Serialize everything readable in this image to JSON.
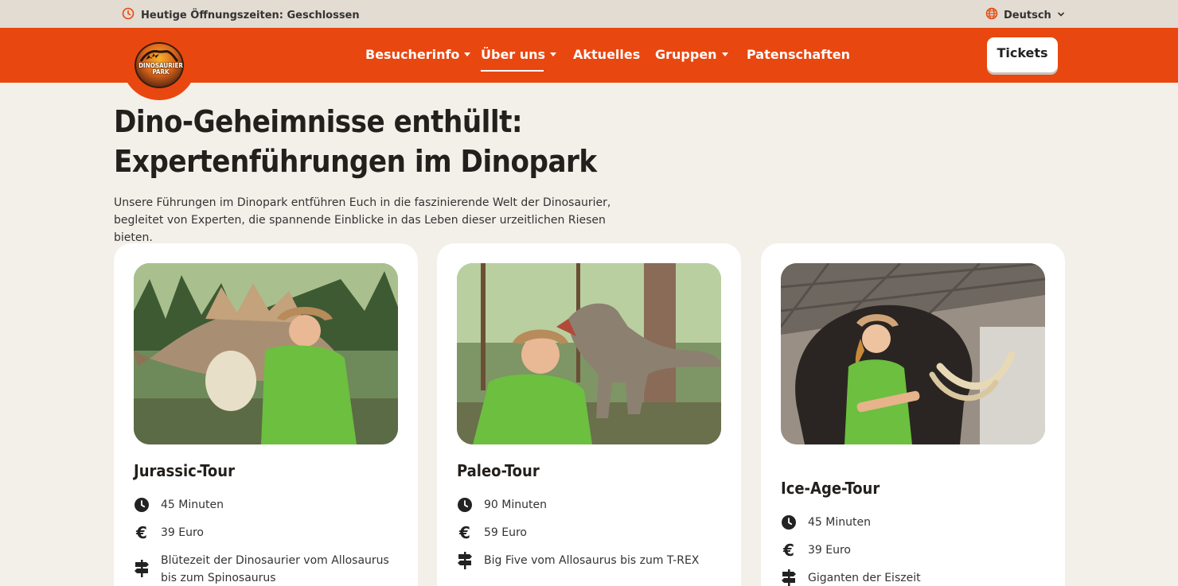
{
  "topbar": {
    "hours": "Heutige Öffnungszeiten: Geschlossen",
    "language": "Deutsch"
  },
  "logo": {
    "text_line1": "DINOSAURIER",
    "text_line2": "PARK"
  },
  "nav": {
    "items": [
      {
        "label": "Besucherinfo"
      },
      {
        "label": "Über uns"
      },
      {
        "label": "Aktuelles"
      },
      {
        "label": "Gruppen"
      },
      {
        "label": "Patenschaften"
      }
    ],
    "tickets": "Tickets"
  },
  "hero": {
    "title_line1": "Dino-Geheimnisse enthüllt:",
    "title_line2": "Expertenführungen im Dinopark",
    "intro_line1": "Unsere Führungen im Dinopark entführen Euch in die faszinierende Welt der Dinosaurier,",
    "intro_line2": "begleitet von Experten, die spannende Einblicke in das Leben dieser urzeitlichen Riesen bieten."
  },
  "tours": [
    {
      "title": "Jurassic-Tour",
      "duration": "45 Minuten",
      "price": "39 Euro",
      "highlight": "Blütezeit der Dinosaurier vom Allosaurus bis zum Spinosaurus"
    },
    {
      "title": "Paleo-Tour",
      "duration": "90 Minuten",
      "price": "59 Euro",
      "highlight": "Big Five vom Allosaurus bis zum T-REX"
    },
    {
      "title": "Ice-Age-Tour",
      "duration": "45 Minuten",
      "price": "39 Euro",
      "highlight": "Giganten der Eiszeit"
    }
  ],
  "colors": {
    "brand_orange": "#e94710",
    "background": "#f3efe9",
    "topbar": "#e2dcd2"
  }
}
